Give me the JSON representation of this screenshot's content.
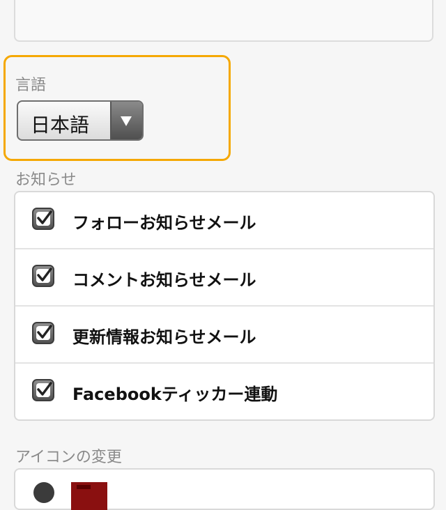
{
  "language": {
    "label": "言語",
    "selected": "日本語"
  },
  "notifications": {
    "label": "お知らせ",
    "items": [
      {
        "label": "フォローお知らせメール",
        "checked": true
      },
      {
        "label": "コメントお知らせメール",
        "checked": true
      },
      {
        "label": "更新情報お知らせメール",
        "checked": true
      },
      {
        "label": "Facebookティッカー連動",
        "checked": true
      }
    ]
  },
  "icon_section": {
    "label": "アイコンの変更"
  },
  "colors": {
    "focus_outline": "#f5a800",
    "checkbox_dark": "#525252"
  }
}
